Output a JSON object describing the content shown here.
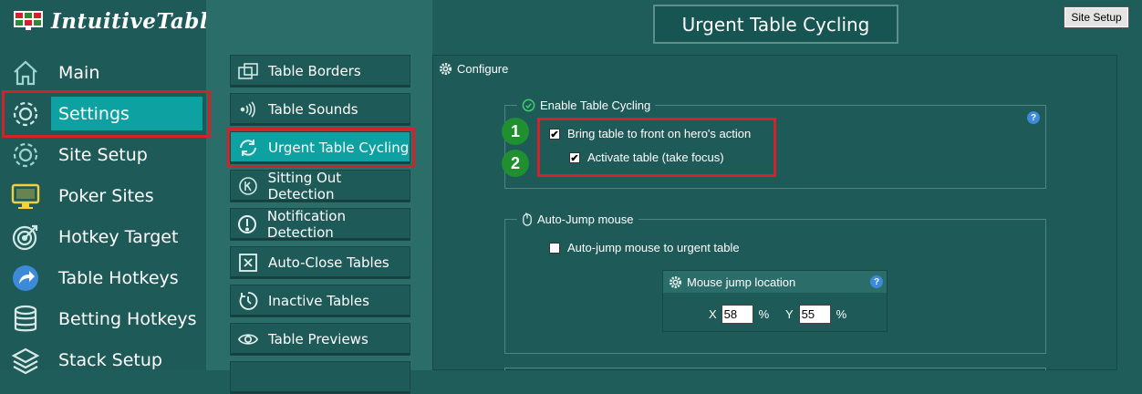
{
  "app": {
    "name": "IntuitiveTables"
  },
  "header": {
    "title": "Urgent Table Cycling",
    "site_setup_button": "Site Setup"
  },
  "sidebar": {
    "items": [
      {
        "label": "Main",
        "icon": "home-icon"
      },
      {
        "label": "Settings",
        "icon": "gear-icon",
        "active": true
      },
      {
        "label": "Site Setup",
        "icon": "gear-icon"
      },
      {
        "label": "Poker Sites",
        "icon": "monitor-icon"
      },
      {
        "label": "Hotkey Target",
        "icon": "target-icon"
      },
      {
        "label": "Table Hotkeys",
        "icon": "forward-arrow-icon"
      },
      {
        "label": "Betting Hotkeys",
        "icon": "chip-stack-icon"
      },
      {
        "label": "Stack Setup",
        "icon": "layers-icon"
      }
    ]
  },
  "submenu": {
    "items": [
      {
        "label": "Table Borders",
        "icon": "borders-icon"
      },
      {
        "label": "Table Sounds",
        "icon": "sound-icon"
      },
      {
        "label": "Urgent Table Cycling",
        "icon": "cycle-icon",
        "active": true
      },
      {
        "label": "Sitting Out Detection",
        "icon": "sitting-out-icon"
      },
      {
        "label": "Notification Detection",
        "icon": "alert-icon"
      },
      {
        "label": "Auto-Close Tables",
        "icon": "close-box-icon"
      },
      {
        "label": "Inactive Tables",
        "icon": "timer-icon"
      },
      {
        "label": "Table Previews",
        "icon": "eye-icon"
      }
    ]
  },
  "configure": {
    "title": "Configure",
    "cycling": {
      "legend": "Enable Table Cycling",
      "bring_front": {
        "label": "Bring table to front on hero's action",
        "checked": true
      },
      "activate": {
        "label": "Activate table (take focus)",
        "checked": true
      }
    },
    "autojump": {
      "legend": "Auto-Jump mouse",
      "checkbox": {
        "label": "Auto-jump mouse to urgent table",
        "checked": false
      },
      "location": {
        "title": "Mouse jump location",
        "x_label": "X",
        "x_value": "58",
        "x_unit": "%",
        "y_label": "Y",
        "y_value": "55",
        "y_unit": "%"
      }
    }
  },
  "annotations": {
    "badge1": "1",
    "badge2": "2"
  },
  "help_icon": "?",
  "check_mark": "✔",
  "colors": {
    "accent": "#0ea1a1",
    "highlight": "#d3232a",
    "badge": "#1f8f2f",
    "help": "#3c8ad8"
  }
}
